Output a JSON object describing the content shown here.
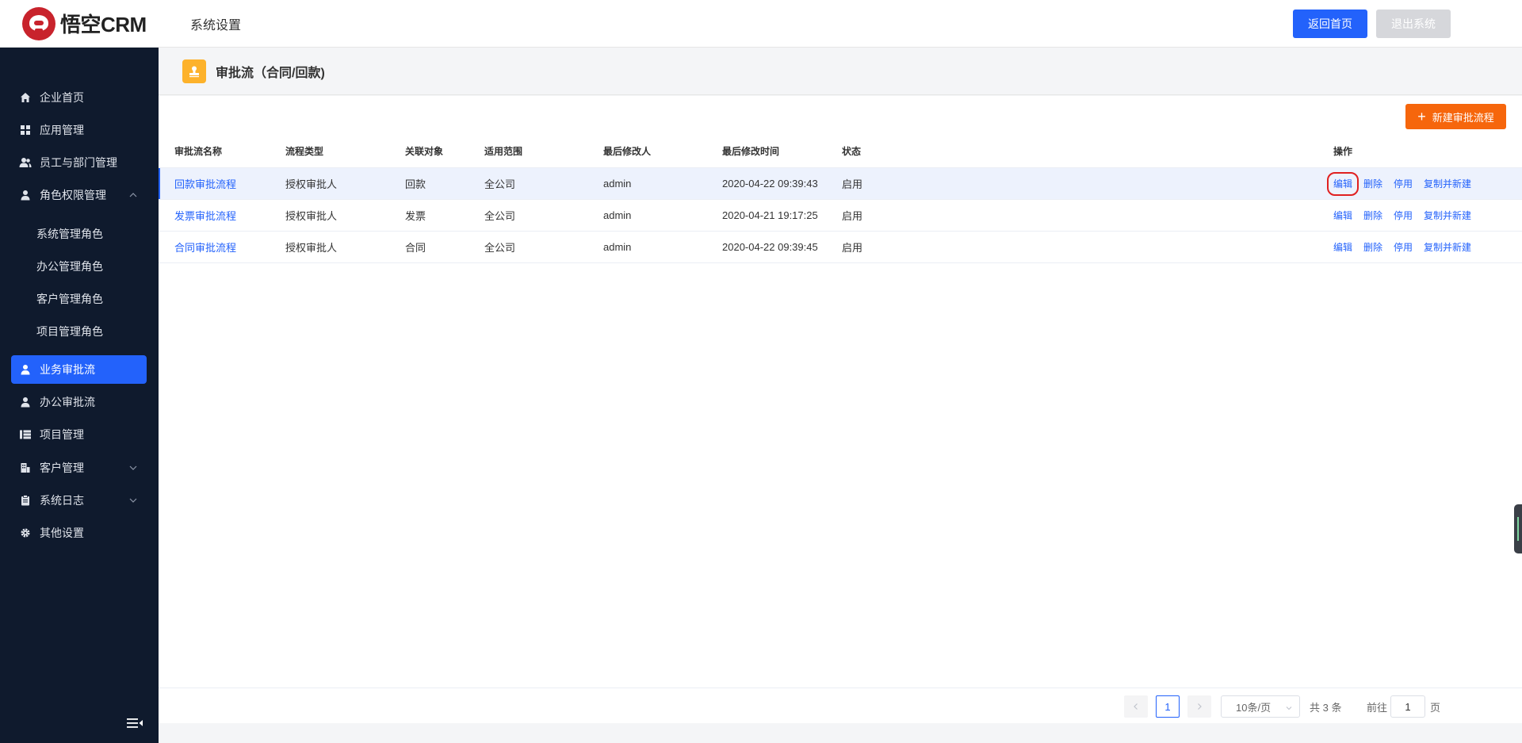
{
  "header": {
    "logo_text": "悟空CRM",
    "title": "系统设置",
    "home_button": "返回首页",
    "exit_button": "退出系统"
  },
  "sidebar": {
    "items": [
      {
        "label": "企业首页",
        "icon": "home-icon"
      },
      {
        "label": "应用管理",
        "icon": "apps-icon"
      },
      {
        "label": "员工与部门管理",
        "icon": "users-icon"
      },
      {
        "label": "角色权限管理",
        "icon": "user-icon",
        "expanded": true
      },
      {
        "label": "业务审批流",
        "icon": "user-icon",
        "active": true
      },
      {
        "label": "办公审批流",
        "icon": "user-icon"
      },
      {
        "label": "项目管理",
        "icon": "project-icon"
      },
      {
        "label": "客户管理",
        "icon": "building-icon",
        "expandable": true
      },
      {
        "label": "系统日志",
        "icon": "clipboard-icon",
        "expandable": true
      },
      {
        "label": "其他设置",
        "icon": "gear-icon"
      }
    ],
    "sub_items": [
      "系统管理角色",
      "办公管理角色",
      "客户管理角色",
      "项目管理角色"
    ]
  },
  "page": {
    "title": "审批流（合同/回款)",
    "new_button": "新建审批流程"
  },
  "table": {
    "columns": [
      "审批流名称",
      "流程类型",
      "关联对象",
      "适用范围",
      "最后修改人",
      "最后修改时间",
      "状态",
      "操作"
    ],
    "rows": [
      {
        "name": "回款审批流程",
        "type": "授权审批人",
        "object": "回款",
        "scope": "全公司",
        "modifier": "admin",
        "time": "2020-04-22 09:39:43",
        "status": "启用"
      },
      {
        "name": "发票审批流程",
        "type": "授权审批人",
        "object": "发票",
        "scope": "全公司",
        "modifier": "admin",
        "time": "2020-04-21 19:17:25",
        "status": "启用"
      },
      {
        "name": "合同审批流程",
        "type": "授权审批人",
        "object": "合同",
        "scope": "全公司",
        "modifier": "admin",
        "time": "2020-04-22 09:39:45",
        "status": "启用"
      }
    ],
    "actions": {
      "edit": "编辑",
      "delete": "删除",
      "disable": "停用",
      "copy": "复制并新建"
    }
  },
  "pagination": {
    "current_page": "1",
    "page_size": "10条/页",
    "total": "共 3 条",
    "goto_label": "前往",
    "goto_value": "1",
    "page_unit": "页"
  },
  "colors": {
    "primary": "#2362fb",
    "sidebar_bg": "#0f1a2d",
    "new_button": "#f6660c",
    "highlight_box": "#e02020"
  }
}
